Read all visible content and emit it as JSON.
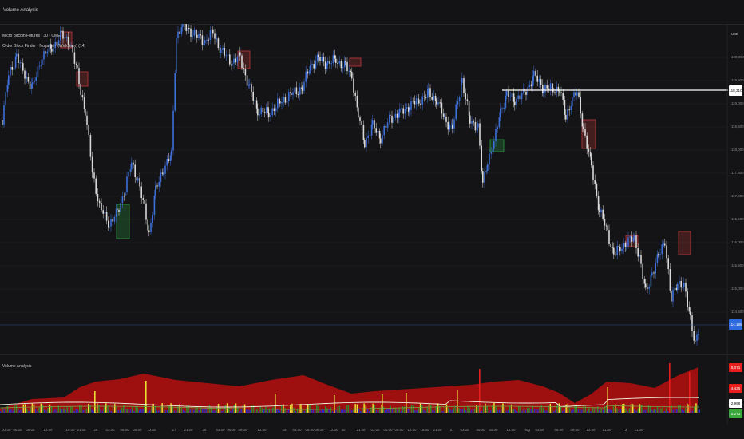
{
  "window": {
    "title": "Volume Analysis"
  },
  "main_pane": {
    "legend_line1": "Micro Bitcoin Futures · 30 · CME",
    "legend_line2": "Order Block Finder · Nuganzi · (Wickvisor) (14)",
    "currency": "USD",
    "price_ticks": [
      "120,000",
      "119,500",
      "119,000",
      "118,500",
      "118,000",
      "117,500",
      "117,000",
      "116,500",
      "116,000",
      "115,500",
      "115,000",
      "114,500"
    ],
    "horizontal_line_label": "118,310",
    "last_price_label": "114,185",
    "colors": {
      "bull": "#3d6fd6",
      "bear": "#d8d8d8",
      "bear_block": "#c0393b",
      "bull_block": "#2f9e44",
      "last_price": "#2d6ae0"
    }
  },
  "volume_pane": {
    "title": "Volume Analysis",
    "labels": [
      {
        "text": "6,071",
        "color": "#e81e1e"
      },
      {
        "text": "4,435",
        "color": "#e81e1e"
      },
      {
        "text": "2,998",
        "color": "#ffffff"
      },
      {
        "text": "0.273",
        "color": "#3aa83a"
      }
    ],
    "colors": {
      "band": "#9e1010",
      "high": "#e8e032",
      "mid": "#2d8a2d",
      "low": "#2b2bc2",
      "line_a": "#f2f2e0",
      "line_b": "#7aa24a"
    }
  },
  "time_axis": {
    "ticks": [
      "03:00",
      "06:00",
      "09:00",
      "12:00",
      "18:00",
      "21:00",
      "25",
      "03:00",
      "06:00",
      "09:00",
      "12:00",
      "27",
      "21:00",
      "28",
      "03:00",
      "06:00",
      "09:00",
      "12:00",
      "29",
      "03:00",
      "06:00",
      "09:00",
      "12:00",
      "30",
      "21:00",
      "03:00",
      "06:00",
      "09:00",
      "12:00",
      "18:00",
      "21:00",
      "31",
      "03:00",
      "06:00",
      "09:00",
      "12:00",
      "Aug",
      "03:00",
      "06:00",
      "09:00",
      "12:00",
      "21:00",
      "3",
      "21:00"
    ]
  }
}
